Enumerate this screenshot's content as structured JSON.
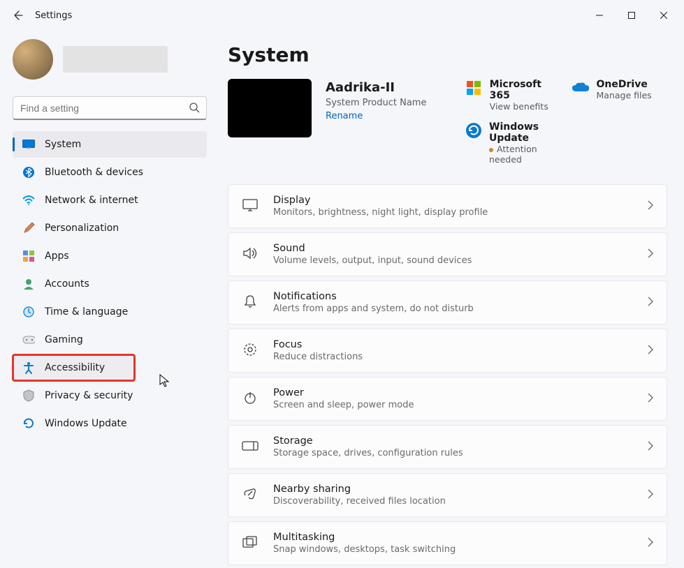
{
  "window": {
    "title": "Settings"
  },
  "search": {
    "placeholder": "Find a setting"
  },
  "nav": [
    {
      "key": "system",
      "label": "System"
    },
    {
      "key": "bluetooth",
      "label": "Bluetooth & devices"
    },
    {
      "key": "network",
      "label": "Network & internet"
    },
    {
      "key": "personalization",
      "label": "Personalization"
    },
    {
      "key": "apps",
      "label": "Apps"
    },
    {
      "key": "accounts",
      "label": "Accounts"
    },
    {
      "key": "time-language",
      "label": "Time & language"
    },
    {
      "key": "gaming",
      "label": "Gaming"
    },
    {
      "key": "accessibility",
      "label": "Accessibility"
    },
    {
      "key": "privacy",
      "label": "Privacy & security"
    },
    {
      "key": "windows-update",
      "label": "Windows Update"
    }
  ],
  "page": {
    "heading": "System",
    "device": {
      "name": "Aadrika-II",
      "product": "System Product Name",
      "rename": "Rename"
    }
  },
  "quicklinks": {
    "m365": {
      "title": "Microsoft 365",
      "sub": "View benefits"
    },
    "onedrive": {
      "title": "OneDrive",
      "sub": "Manage files"
    },
    "update": {
      "title": "Windows Update",
      "sub": "Attention needed"
    }
  },
  "cards": [
    {
      "key": "display",
      "title": "Display",
      "sub": "Monitors, brightness, night light, display profile"
    },
    {
      "key": "sound",
      "title": "Sound",
      "sub": "Volume levels, output, input, sound devices"
    },
    {
      "key": "notifications",
      "title": "Notifications",
      "sub": "Alerts from apps and system, do not disturb"
    },
    {
      "key": "focus",
      "title": "Focus",
      "sub": "Reduce distractions"
    },
    {
      "key": "power",
      "title": "Power",
      "sub": "Screen and sleep, power mode"
    },
    {
      "key": "storage",
      "title": "Storage",
      "sub": "Storage space, drives, configuration rules"
    },
    {
      "key": "nearby",
      "title": "Nearby sharing",
      "sub": "Discoverability, received files location"
    },
    {
      "key": "multitasking",
      "title": "Multitasking",
      "sub": "Snap windows, desktops, task switching"
    }
  ]
}
